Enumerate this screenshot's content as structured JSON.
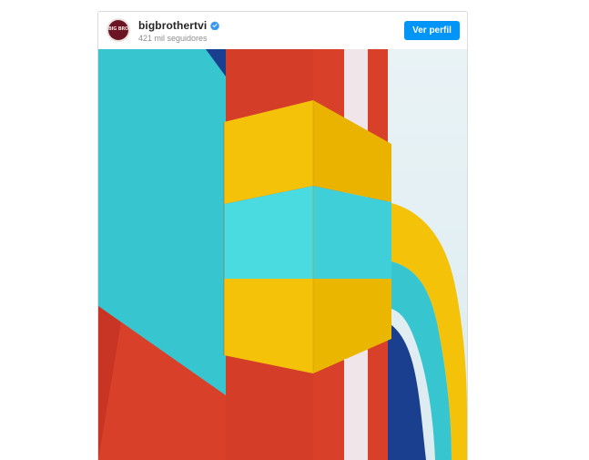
{
  "post": {
    "account": {
      "username": "bigbrothertvi",
      "followers": "421 mil seguidores",
      "verified": true,
      "avatar_text": "BIG BROTHER"
    },
    "actions": {
      "view_profile_label": "Ver perfil"
    },
    "media": {
      "type": "image",
      "subject": "colorful-geometric-wall-art"
    }
  },
  "colors": {
    "button": "#0095f6",
    "verified_badge": "#3897f0",
    "cyan": "#37c6cf",
    "yellow": "#f5c20a",
    "red": "#d9402a",
    "navy": "#1b3f8f"
  },
  "icons": {
    "verified": "verified-badge-icon",
    "avatar": "profile-avatar"
  }
}
